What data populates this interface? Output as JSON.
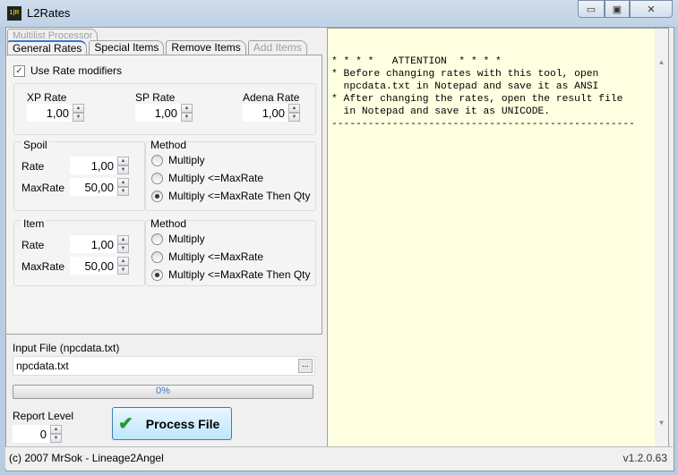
{
  "window": {
    "title": "L2Rates",
    "icon_text": "1|R",
    "minimize": "▭",
    "maximize": "▣",
    "close": "✕"
  },
  "tabs_row1": [
    {
      "label": "Multilist Processor",
      "disabled": true
    }
  ],
  "tabs_row2": [
    {
      "label": "General Rates",
      "active": true
    },
    {
      "label": "Special Items"
    },
    {
      "label": "Remove Items"
    },
    {
      "label": "Add Items",
      "disabled": true
    }
  ],
  "general": {
    "use_modifiers": {
      "label": "Use Rate modifiers",
      "checked": true
    },
    "xp": {
      "label": "XP Rate",
      "value": "1,00"
    },
    "sp": {
      "label": "SP Rate",
      "value": "1,00"
    },
    "adena": {
      "label": "Adena Rate",
      "value": "1,00"
    },
    "spoil": {
      "title": "Spoil",
      "rate_label": "Rate",
      "rate": "1,00",
      "max_label": "MaxRate",
      "max": "50,00",
      "method_title": "Method",
      "methods": [
        "Multiply",
        "Multiply <=MaxRate",
        "Multiply <=MaxRate Then Qty"
      ],
      "selected": 2
    },
    "item": {
      "title": "Item",
      "rate_label": "Rate",
      "rate": "1,00",
      "max_label": "MaxRate",
      "max": "50,00",
      "method_title": "Method",
      "methods": [
        "Multiply",
        "Multiply <=MaxRate",
        "Multiply <=MaxRate Then Qty"
      ],
      "selected": 2
    }
  },
  "input_file": {
    "label": "Input File (npcdata.txt)",
    "value": "npcdata.txt",
    "browse": "..."
  },
  "progress": {
    "percent": 0,
    "label": "0%"
  },
  "report": {
    "label": "Report Level",
    "value": "0"
  },
  "process_button": "Process File",
  "memo": "* * * *   ATTENTION  * * * *\n* Before changing rates with this tool, open\n  npcdata.txt in Notepad and save it as ANSI\n* After changing the rates, open the result file\n  in Notepad and save it as UNICODE.\n--------------------------------------------------",
  "status": {
    "left": "(c) 2007 MrSok - Lineage2Angel",
    "right": "v1.2.0.63"
  },
  "colors": {
    "memo_bg": "#ffffe1",
    "accent": "#3a78c8",
    "check": "#2a9a2a"
  }
}
